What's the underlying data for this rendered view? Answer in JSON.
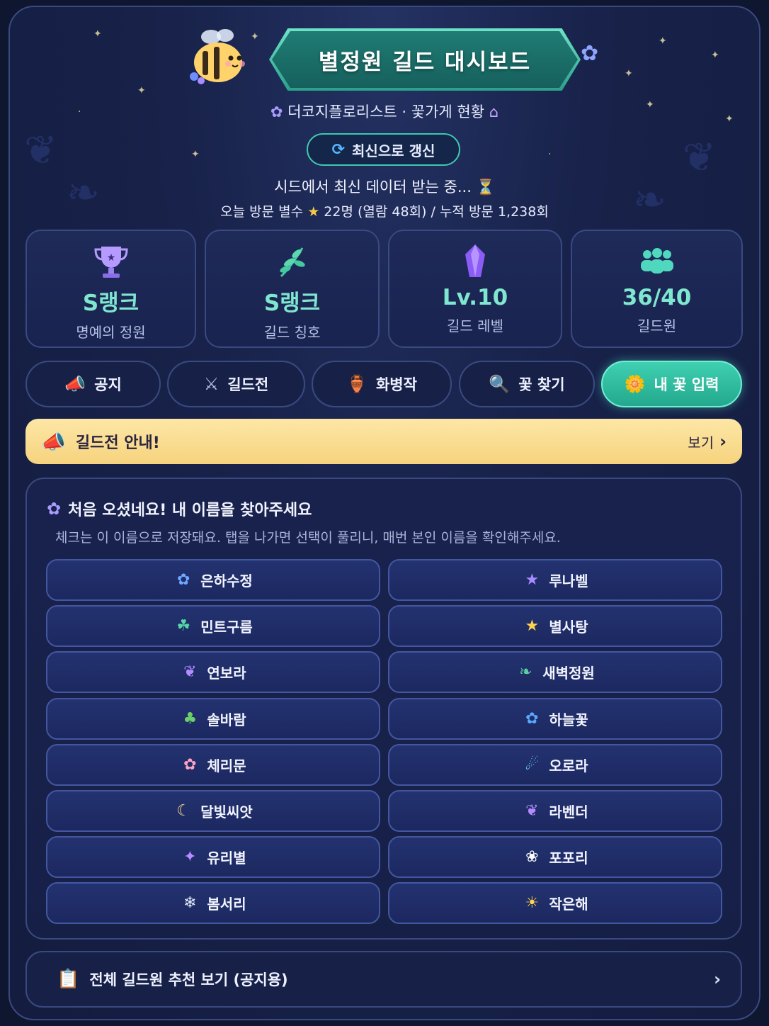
{
  "header": {
    "title": "별정원 길드 대시보드",
    "subtitle": "더코지플로리스트 · 꽃가게 현황",
    "refresh_label": "최신으로 갱신",
    "status_text": "시드에서 최신 데이터 받는 중... ⏳",
    "visit_prefix": "오늘 방문 별수",
    "visit_stats": "22명 (열람 48회) / 누적 방문 1,238회"
  },
  "stats": [
    {
      "value": "S랭크",
      "label": "명예의 정원",
      "icon": "trophy-icon"
    },
    {
      "value": "S랭크",
      "label": "길드 칭호",
      "icon": "leaf-sprig-icon"
    },
    {
      "value": "Lv.10",
      "label": "길드 레벨",
      "icon": "crystal-icon"
    },
    {
      "value": "36/40",
      "label": "길드원",
      "icon": "members-icon"
    }
  ],
  "tabs": [
    {
      "label": "공지",
      "icon": "megaphone-icon",
      "glyph": "📣"
    },
    {
      "label": "길드전",
      "icon": "crossed-swords-icon",
      "glyph": "⚔"
    },
    {
      "label": "화병작",
      "icon": "vase-icon",
      "glyph": "🏺"
    },
    {
      "label": "꽃 찾기",
      "icon": "magnifier-icon",
      "glyph": "🔍"
    },
    {
      "label": "내 꽃 입력",
      "icon": "daisy-icon",
      "glyph": "🌼",
      "active": true
    }
  ],
  "notice": {
    "title": "길드전 안내!",
    "link_label": "보기"
  },
  "name_picker": {
    "title": "처음 오셨네요! 내 이름을 찾아주세요",
    "description": "체크는 이 이름으로 저장돼요. 탭을 나가면 선택이 풀리니, 매번 본인 이름을 확인해주세요.",
    "names": [
      {
        "name": "은하수정",
        "icon": "blue-flower-icon",
        "glyph": "✿",
        "color": "#6fa8ff"
      },
      {
        "name": "루나벨",
        "icon": "purple-star-icon",
        "glyph": "★",
        "color": "#a98cff"
      },
      {
        "name": "민트구름",
        "icon": "clover-icon",
        "glyph": "☘",
        "color": "#57d6a8"
      },
      {
        "name": "별사탕",
        "icon": "yellow-star-icon",
        "glyph": "★",
        "color": "#ffd34d"
      },
      {
        "name": "연보라",
        "icon": "lavender-icon",
        "glyph": "❦",
        "color": "#b48cff"
      },
      {
        "name": "새벽정원",
        "icon": "leaf-icon",
        "glyph": "❧",
        "color": "#5bd0a0"
      },
      {
        "name": "솔바람",
        "icon": "sprout-icon",
        "glyph": "♣",
        "color": "#6ccf6a"
      },
      {
        "name": "하늘꽃",
        "icon": "sky-flower-icon",
        "glyph": "✿",
        "color": "#5aa9ff"
      },
      {
        "name": "체리문",
        "icon": "cherry-blossom-icon",
        "glyph": "✿",
        "color": "#ffa3c4"
      },
      {
        "name": "오로라",
        "icon": "comet-icon",
        "glyph": "☄",
        "color": "#6fd8ff"
      },
      {
        "name": "달빛씨앗",
        "icon": "crescent-moon-icon",
        "glyph": "☾",
        "color": "#ffe08a"
      },
      {
        "name": "라벤더",
        "icon": "lavender-sprig-icon",
        "glyph": "❦",
        "color": "#b48cff"
      },
      {
        "name": "유리별",
        "icon": "sparkle-crystal-icon",
        "glyph": "✦",
        "color": "#b98cff"
      },
      {
        "name": "포포리",
        "icon": "white-flower-icon",
        "glyph": "❀",
        "color": "#ffffff"
      },
      {
        "name": "봄서리",
        "icon": "snowflake-icon",
        "glyph": "❄",
        "color": "#e6efff"
      },
      {
        "name": "작은해",
        "icon": "sun-icon",
        "glyph": "☀",
        "color": "#ffd34d"
      }
    ]
  },
  "footer": {
    "label": "전체 길드원 추천 보기 (공지용)"
  }
}
